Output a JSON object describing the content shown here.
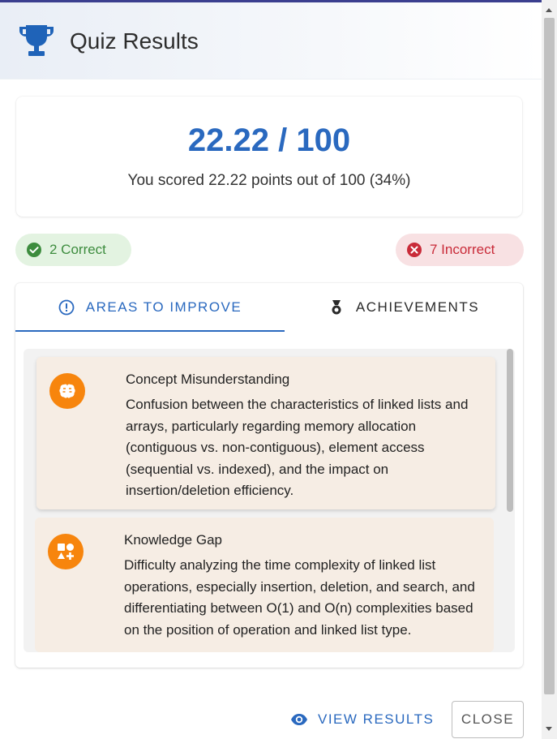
{
  "header": {
    "title": "Quiz Results",
    "icon": "trophy-icon"
  },
  "score": {
    "main": "22.22 / 100",
    "summary": "You scored 22.22 points out of 100 (34%)"
  },
  "stats": {
    "correct_label": "2 Correct",
    "incorrect_label": "7 Incorrect"
  },
  "tabs": [
    {
      "label": "AREAS TO IMPROVE",
      "icon": "info-circle-icon",
      "active": true
    },
    {
      "label": "ACHIEVEMENTS",
      "icon": "medal-icon",
      "active": false
    }
  ],
  "improvements": [
    {
      "title": "Concept Misunderstanding",
      "icon": "brain-icon",
      "text": "Confusion between the characteristics of linked lists and arrays, particularly regarding memory allocation (contiguous vs. non-contiguous), element access (sequential vs. indexed), and the impact on insertion/deletion efficiency."
    },
    {
      "title": "Knowledge Gap",
      "icon": "shapes-icon",
      "text": "Difficulty analyzing the time complexity of linked list operations, especially insertion, deletion, and search, and differentiating between O(1) and O(n) complexities based on the position of operation and linked list type."
    }
  ],
  "footer": {
    "view_results_label": "VIEW RESULTS",
    "close_label": "CLOSE"
  },
  "colors": {
    "primary": "#2a69bf",
    "correct": "#3d8c3e",
    "incorrect": "#c92b39",
    "accent_orange": "#f7850d"
  }
}
